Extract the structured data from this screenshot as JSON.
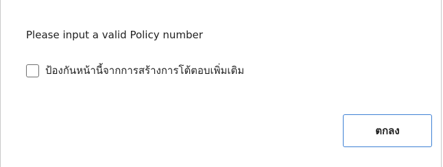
{
  "dialog": {
    "message": "Please input a valid Policy number",
    "suppress_checkbox": {
      "label": "ป้องกันหน้านี้จากการสร้างการโต้ตอบเพิ่มเติม",
      "checked": false
    },
    "ok_button_label": "ตกลง",
    "accent_color": "#3c7fd4"
  }
}
